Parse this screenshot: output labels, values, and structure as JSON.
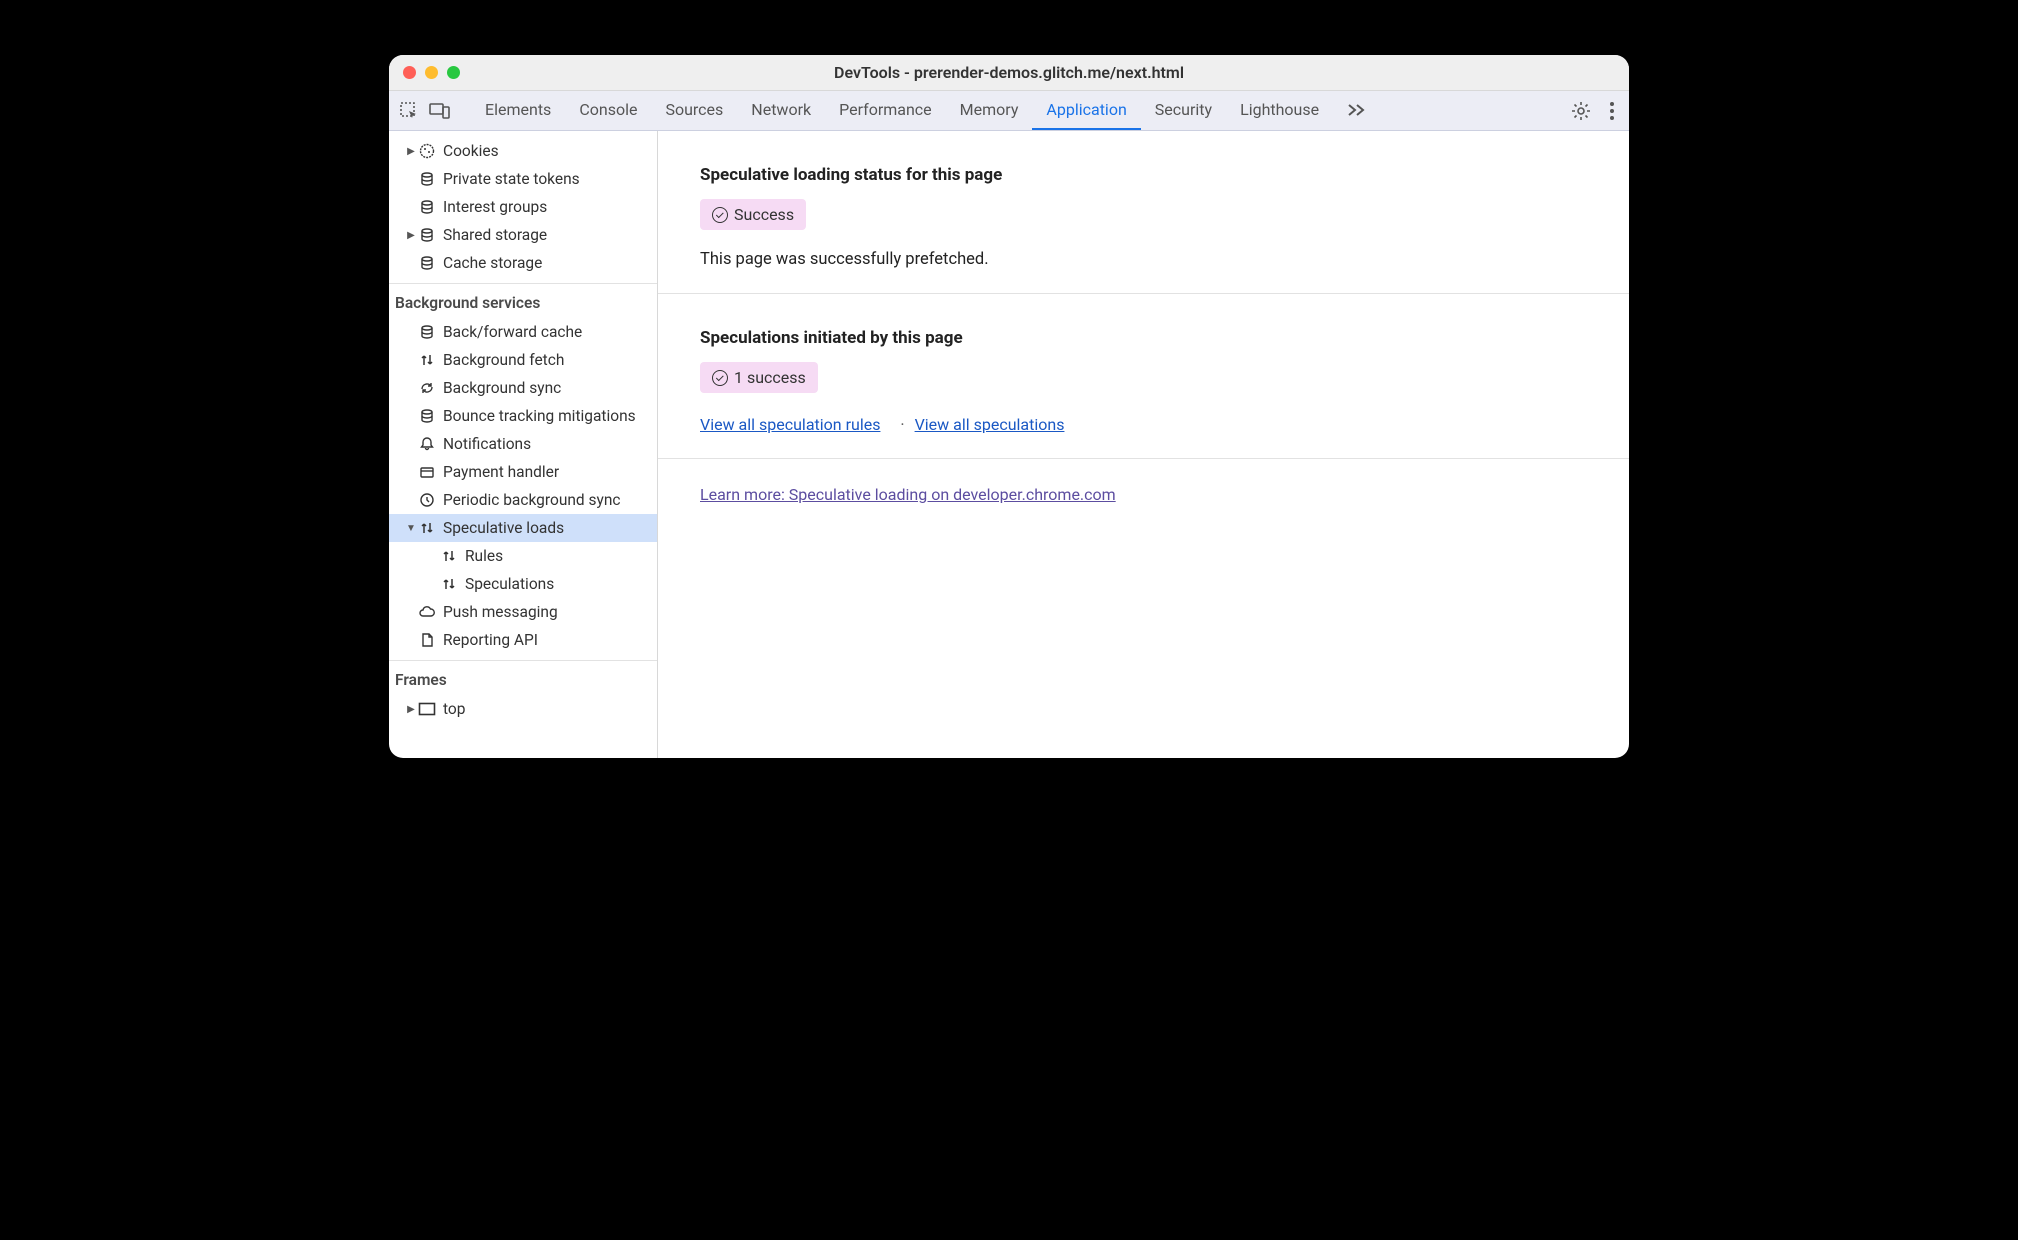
{
  "window_title": "DevTools - prerender-demos.glitch.me/next.html",
  "tabs": [
    "Elements",
    "Console",
    "Sources",
    "Network",
    "Performance",
    "Memory",
    "Application",
    "Security",
    "Lighthouse"
  ],
  "active_tab": "Application",
  "sidebar": {
    "storage": [
      {
        "label": "Cookies",
        "icon": "cookie",
        "chev": "right"
      },
      {
        "label": "Private state tokens",
        "icon": "db"
      },
      {
        "label": "Interest groups",
        "icon": "db"
      },
      {
        "label": "Shared storage",
        "icon": "db",
        "chev": "right"
      },
      {
        "label": "Cache storage",
        "icon": "db"
      }
    ],
    "bg_header": "Background services",
    "bg_items": [
      {
        "label": "Back/forward cache",
        "icon": "db"
      },
      {
        "label": "Background fetch",
        "icon": "updown"
      },
      {
        "label": "Background sync",
        "icon": "sync"
      },
      {
        "label": "Bounce tracking mitigations",
        "icon": "db"
      },
      {
        "label": "Notifications",
        "icon": "bell"
      },
      {
        "label": "Payment handler",
        "icon": "card"
      },
      {
        "label": "Periodic background sync",
        "icon": "clock"
      },
      {
        "label": "Speculative loads",
        "icon": "updown",
        "chev": "down",
        "selected": true,
        "children": [
          {
            "label": "Rules",
            "icon": "updown"
          },
          {
            "label": "Speculations",
            "icon": "updown"
          }
        ]
      },
      {
        "label": "Push messaging",
        "icon": "cloud"
      },
      {
        "label": "Reporting API",
        "icon": "doc"
      }
    ],
    "frames_header": "Frames",
    "frames": [
      {
        "label": "top",
        "icon": "frame",
        "chev": "right"
      }
    ]
  },
  "main": {
    "status_heading": "Speculative loading status for this page",
    "status_badge": "Success",
    "status_body": "This page was successfully prefetched.",
    "spec_heading": "Speculations initiated by this page",
    "spec_badge": "1 success",
    "link_rules": "View all speculation rules",
    "link_specs": "View all speculations",
    "learn_more": "Learn more: Speculative loading on developer.chrome.com"
  }
}
